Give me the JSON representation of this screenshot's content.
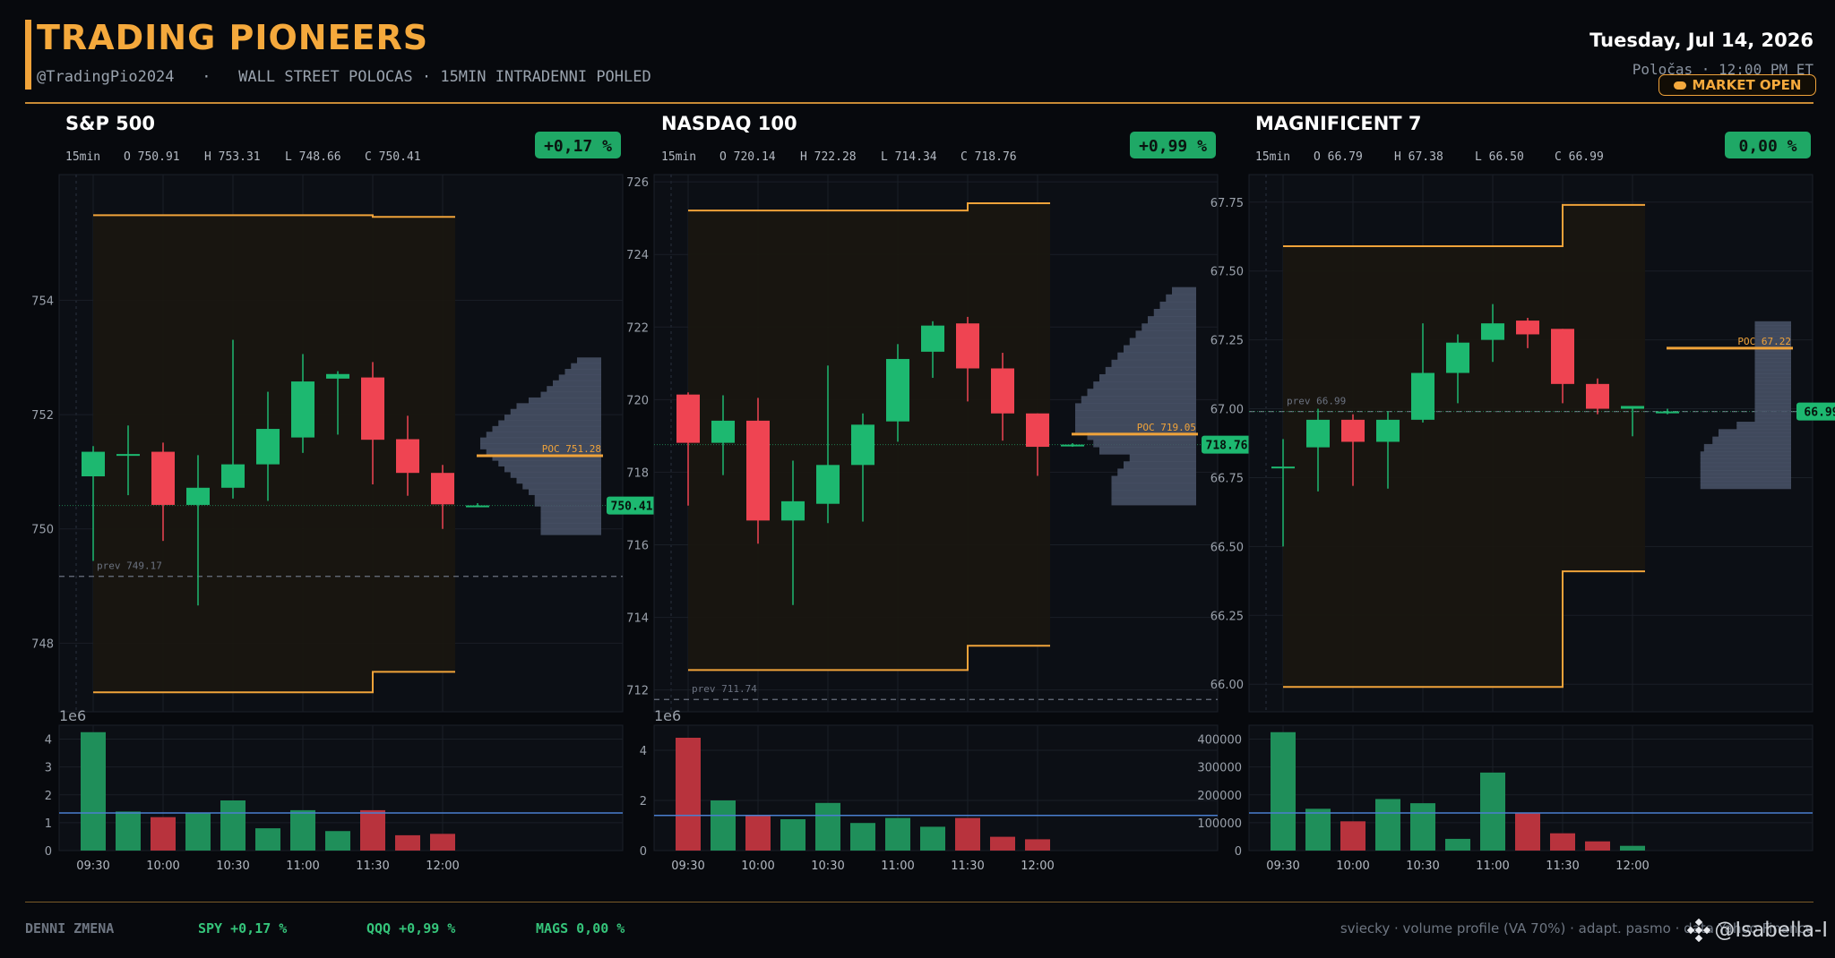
{
  "header": {
    "title": "TRADING PIONEERS",
    "subtitle": "@TradingPio2024   ·   WALL STREET POLOCAS · 15MIN INTRADENNI POHLED",
    "date": "Tuesday, Jul 14, 2026",
    "session": "Poločas · 12:00 PM ET",
    "status": "MARKET OPEN",
    "accent_color": "#f0a33a"
  },
  "footer": {
    "label": "DENNI ZMENA",
    "changes": [
      "SPY +0,17 %",
      "QQQ +0,99 %",
      "MAGS 0,00 %"
    ],
    "note": "sviecky · volume profile (VA 70%) · adapt. pasmo · data Yahoo Finance",
    "watermark": "@Isabella-I",
    "watermark_icon": "binance-logo-icon"
  },
  "colors": {
    "up": "#1db870",
    "down": "#ef4452",
    "vol_up": "#1f8f5a",
    "vol_down": "#b8333d",
    "band": "#f0a33a",
    "avg_line": "#4a7fd0"
  },
  "chart_data": [
    {
      "type": "candlestick",
      "title": "S&P 500",
      "interval": "15min",
      "ohlc_label": {
        "o": "O 750.91",
        "h": "H 753.31",
        "l": "L 748.66",
        "c": "C 750.41"
      },
      "change": "+0,17 %",
      "x": [
        "09:30",
        "09:45",
        "10:00",
        "10:15",
        "10:30",
        "10:45",
        "11:00",
        "11:15",
        "11:30",
        "11:45",
        "12:00",
        "12:15"
      ],
      "xticks": [
        "09:30",
        "10:00",
        "10:30",
        "11:00",
        "11:30",
        "12:00"
      ],
      "ylim": [
        746.8,
        756.2
      ],
      "yticks": [
        748,
        750,
        752,
        754
      ],
      "open": [
        750.92,
        751.31,
        751.35,
        750.42,
        750.72,
        751.13,
        751.6,
        752.63,
        752.65,
        751.57,
        750.98,
        750.41
      ],
      "high": [
        751.45,
        751.81,
        751.51,
        751.29,
        753.31,
        752.4,
        753.06,
        752.76,
        752.92,
        751.98,
        751.12,
        750.45
      ],
      "low": [
        749.44,
        750.59,
        749.79,
        748.66,
        750.53,
        750.49,
        751.33,
        751.65,
        750.78,
        750.58,
        750.0,
        750.38
      ],
      "close": [
        751.35,
        751.31,
        750.42,
        750.72,
        751.13,
        751.75,
        752.58,
        752.71,
        751.56,
        750.98,
        750.43,
        750.41
      ],
      "prev_close": 749.17,
      "prev_label": "prev 749.17",
      "last_price": 750.41,
      "last_label": "750.41",
      "poc": 751.28,
      "poc_label": "POC 751.28",
      "band_upper": [
        755.49,
        755.49,
        755.49,
        755.49,
        755.49,
        755.49,
        755.49,
        755.49,
        755.46,
        755.46,
        755.46
      ],
      "band_lower": [
        747.14,
        747.14,
        747.14,
        747.14,
        747.14,
        747.14,
        747.14,
        747.14,
        747.5,
        747.5,
        747.5
      ],
      "profile": {
        "low": 749.9,
        "step": 0.1,
        "widths": [
          0.5,
          0.5,
          0.5,
          0.5,
          0.5,
          0.55,
          0.55,
          0.6,
          0.65,
          0.7,
          0.75,
          0.8,
          0.85,
          0.9,
          0.95,
          1.0,
          1.0,
          0.95,
          0.9,
          0.85,
          0.8,
          0.75,
          0.7,
          0.6,
          0.5,
          0.45,
          0.4,
          0.35,
          0.3,
          0.25,
          0.2
        ]
      },
      "volume": {
        "scale_label": "1e6",
        "yticks": [
          0,
          1,
          2,
          3,
          4
        ],
        "ylim": [
          0,
          4.5
        ],
        "values": [
          4.25,
          1.4,
          1.2,
          1.35,
          1.8,
          0.8,
          1.45,
          0.7,
          1.45,
          0.55,
          0.6
        ],
        "avg": 1.35
      }
    },
    {
      "type": "candlestick",
      "title": "NASDAQ 100",
      "interval": "15min",
      "ohlc_label": {
        "o": "O 720.14",
        "h": "H 722.28",
        "l": "L 714.34",
        "c": "C 718.76"
      },
      "change": "+0,99 %",
      "x": [
        "09:30",
        "09:45",
        "10:00",
        "10:15",
        "10:30",
        "10:45",
        "11:00",
        "11:15",
        "11:30",
        "11:45",
        "12:00",
        "12:15"
      ],
      "xticks": [
        "09:30",
        "10:00",
        "10:30",
        "11:00",
        "11:30",
        "12:00"
      ],
      "ylim": [
        711.4,
        726.2
      ],
      "yticks": [
        712,
        714,
        716,
        718,
        720,
        722,
        724,
        726
      ],
      "open": [
        720.14,
        718.81,
        719.42,
        716.67,
        717.13,
        718.2,
        719.4,
        721.32,
        722.1,
        720.86,
        719.62,
        718.76
      ],
      "high": [
        720.2,
        720.12,
        720.05,
        718.32,
        720.94,
        719.62,
        721.53,
        722.16,
        722.28,
        721.29,
        719.62,
        718.8
      ],
      "low": [
        717.08,
        717.92,
        716.03,
        714.34,
        716.6,
        716.64,
        718.84,
        720.6,
        719.95,
        718.87,
        717.9,
        718.7
      ],
      "close": [
        718.81,
        719.42,
        716.67,
        717.2,
        718.2,
        719.31,
        721.12,
        722.04,
        720.86,
        719.62,
        718.7,
        718.76
      ],
      "prev_close": 711.74,
      "prev_label": "prev 711.74",
      "last_price": 718.76,
      "last_label": "718.76",
      "poc": 719.05,
      "poc_label": "POC 719.05",
      "band_upper": [
        725.21,
        725.21,
        725.21,
        725.21,
        725.21,
        725.21,
        725.21,
        725.21,
        725.41,
        725.41,
        725.41
      ],
      "band_lower": [
        712.55,
        712.55,
        712.55,
        712.55,
        712.55,
        712.55,
        712.55,
        712.55,
        713.22,
        713.22,
        713.22
      ],
      "profile": {
        "low": 717.1,
        "step": 0.2,
        "widths": [
          0.7,
          0.7,
          0.7,
          0.7,
          0.65,
          0.6,
          0.55,
          0.8,
          0.85,
          0.9,
          1.0,
          1.0,
          1.0,
          1.0,
          0.95,
          0.9,
          0.85,
          0.8,
          0.75,
          0.7,
          0.65,
          0.6,
          0.55,
          0.5,
          0.45,
          0.4,
          0.35,
          0.3,
          0.25,
          0.2
        ]
      },
      "volume": {
        "scale_label": "1e6",
        "yticks": [
          0,
          2,
          4
        ],
        "ylim": [
          0,
          5
        ],
        "values": [
          4.5,
          2.0,
          1.4,
          1.25,
          1.9,
          1.1,
          1.3,
          0.95,
          1.3,
          0.55,
          0.45
        ],
        "avg": 1.4
      }
    },
    {
      "type": "candlestick",
      "title": "MAGNIFICENT 7",
      "interval": "15min",
      "ohlc_label": {
        "o": "O 66.79",
        "h": "H 67.38",
        "l": "L 66.50",
        "c": "C 66.99"
      },
      "change": "0,00 %",
      "x": [
        "09:30",
        "09:45",
        "10:00",
        "10:15",
        "10:30",
        "10:45",
        "11:00",
        "11:15",
        "11:30",
        "11:45",
        "12:00",
        "12:15"
      ],
      "xticks": [
        "09:30",
        "10:00",
        "10:30",
        "11:00",
        "11:30",
        "12:00"
      ],
      "ylim": [
        65.9,
        67.85
      ],
      "yticks": [
        66.0,
        66.25,
        66.5,
        66.75,
        67.0,
        67.25,
        67.5,
        67.75
      ],
      "open": [
        66.79,
        66.86,
        66.96,
        66.88,
        66.96,
        67.13,
        67.25,
        67.32,
        67.29,
        67.09,
        67.0,
        66.99
      ],
      "high": [
        66.89,
        67.0,
        66.98,
        66.99,
        67.31,
        67.27,
        67.38,
        67.33,
        67.29,
        67.11,
        67.01,
        67.0
      ],
      "low": [
        66.5,
        66.7,
        66.72,
        66.71,
        66.95,
        67.02,
        67.17,
        67.22,
        67.02,
        66.98,
        66.9,
        66.98
      ],
      "close": [
        66.79,
        66.96,
        66.88,
        66.96,
        67.13,
        67.24,
        67.31,
        67.27,
        67.09,
        67.0,
        67.01,
        66.99
      ],
      "prev_close": 66.99,
      "prev_label": "prev 66.99",
      "last_price": 66.99,
      "last_label": "66.99",
      "poc": 67.22,
      "poc_label": "POC 67.22",
      "band_upper": [
        67.59,
        67.59,
        67.59,
        67.59,
        67.59,
        67.59,
        67.59,
        67.59,
        67.74,
        67.74,
        67.74
      ],
      "band_lower": [
        65.99,
        65.99,
        65.99,
        65.99,
        65.99,
        65.99,
        65.99,
        65.99,
        66.41,
        66.41,
        66.41
      ],
      "profile": {
        "low": 66.71,
        "step": 0.0135,
        "widths": [
          0.75,
          0.75,
          0.75,
          0.75,
          0.75,
          0.75,
          0.75,
          0.75,
          0.75,
          0.75,
          0.72,
          0.72,
          0.65,
          0.65,
          0.6,
          0.6,
          0.45,
          0.45,
          0.3,
          0.3,
          0.3,
          0.3,
          0.3,
          0.3,
          0.3,
          0.3,
          0.3,
          0.3,
          0.3,
          0.3,
          0.3,
          0.3,
          0.3,
          0.3,
          0.3,
          0.3,
          0.3,
          0.3,
          0.3,
          0.3,
          0.3,
          0.3,
          0.3,
          0.3,
          0.3
        ]
      },
      "volume": {
        "scale_label": "",
        "yticks": [
          0,
          100000,
          200000,
          300000,
          400000
        ],
        "ylim": [
          0,
          450000
        ],
        "values": [
          425000,
          150000,
          105000,
          185000,
          170000,
          42000,
          280000,
          135000,
          62000,
          33000,
          17000
        ],
        "avg": 135000
      }
    }
  ]
}
